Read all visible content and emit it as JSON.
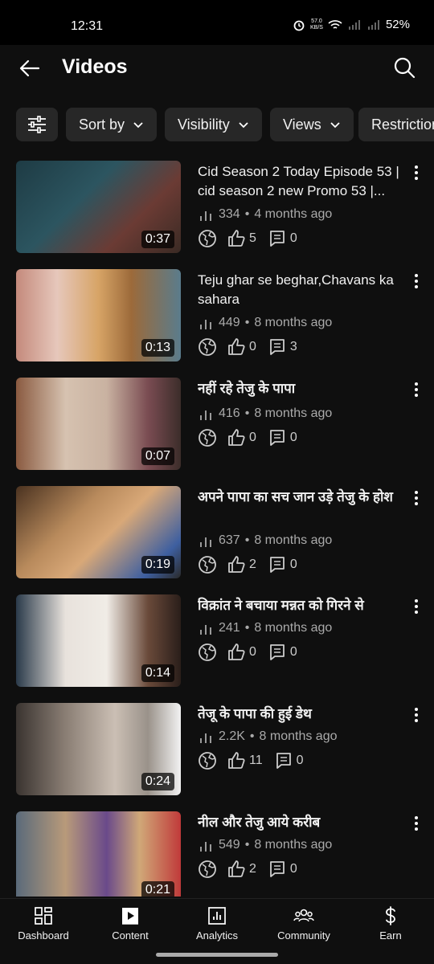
{
  "status": {
    "time": "12:31",
    "speed_value": "57.0",
    "speed_unit": "KB/S",
    "battery": "52%"
  },
  "appbar": {
    "title": "Videos"
  },
  "chips": [
    "Sort by",
    "Visibility",
    "Views",
    "Restrictions"
  ],
  "videos": [
    {
      "title": "Cid Season 2 Today Episode 53 | cid season 2 new Promo 53 |...",
      "views": "334",
      "age": "4 months ago",
      "likes": "5",
      "comments": "0",
      "duration": "0:37"
    },
    {
      "title": "Teju ghar se beghar,Chavans ka sahara",
      "views": "449",
      "age": "8 months ago",
      "likes": "0",
      "comments": "3",
      "duration": "0:13"
    },
    {
      "title": "नहीं रहे तेजु के पापा",
      "views": "416",
      "age": "8 months ago",
      "likes": "0",
      "comments": "0",
      "duration": "0:07"
    },
    {
      "title": "अपने पापा का सच जान उड़े तेजु के होश",
      "views": "637",
      "age": "8 months ago",
      "likes": "2",
      "comments": "0",
      "duration": "0:19"
    },
    {
      "title": "विक्रांत ने बचाया मन्नत को गिरने से",
      "views": "241",
      "age": "8 months ago",
      "likes": "0",
      "comments": "0",
      "duration": "0:14"
    },
    {
      "title": "तेजू के पापा की हुई डेथ",
      "views": "2.2K",
      "age": "8 months ago",
      "likes": "11",
      "comments": "0",
      "duration": "0:24"
    },
    {
      "title": "नील और तेजु आये करीब",
      "views": "549",
      "age": "8 months ago",
      "likes": "2",
      "comments": "0",
      "duration": "0:21"
    }
  ],
  "nav": [
    {
      "label": "Dashboard",
      "icon": "dashboard-icon"
    },
    {
      "label": "Content",
      "icon": "content-icon"
    },
    {
      "label": "Analytics",
      "icon": "analytics-icon"
    },
    {
      "label": "Community",
      "icon": "community-icon"
    },
    {
      "label": "Earn",
      "icon": "dollar-icon"
    }
  ]
}
